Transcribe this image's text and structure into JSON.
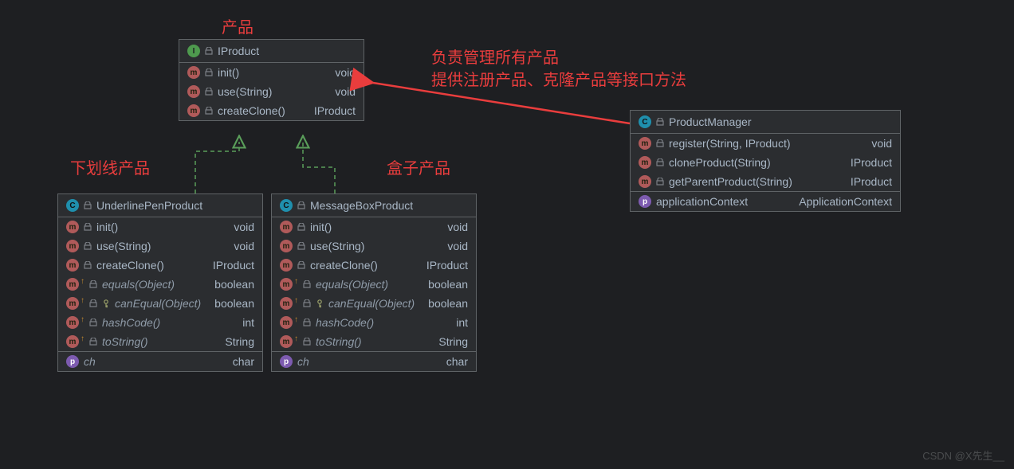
{
  "annotations": {
    "top_center": "产品",
    "left": "下划线产品",
    "middle": "盒子产品",
    "right_line1": "负责管理所有产品",
    "right_line2": "提供注册产品、克隆产品等接口方法"
  },
  "iproduct": {
    "title": "IProduct",
    "rows": [
      {
        "sig": "init()",
        "ret": "void"
      },
      {
        "sig": "use(String)",
        "ret": "void"
      },
      {
        "sig": "createClone()",
        "ret": "IProduct"
      }
    ]
  },
  "underline": {
    "title": "UnderlinePenProduct",
    "rows": [
      {
        "sig": "init()",
        "ret": "void",
        "italic": false,
        "key": false
      },
      {
        "sig": "use(String)",
        "ret": "void",
        "italic": false,
        "key": false
      },
      {
        "sig": "createClone()",
        "ret": "IProduct",
        "italic": false,
        "key": false
      },
      {
        "sig": "equals(Object)",
        "ret": "boolean",
        "italic": true,
        "key": false,
        "up": true
      },
      {
        "sig": "canEqual(Object)",
        "ret": "boolean",
        "italic": true,
        "key": true,
        "up": true
      },
      {
        "sig": "hashCode()",
        "ret": "int",
        "italic": true,
        "key": false,
        "up": true
      },
      {
        "sig": "toString()",
        "ret": "String",
        "italic": true,
        "key": false,
        "up": true
      }
    ],
    "field": {
      "name": "ch",
      "type": "char"
    }
  },
  "messagebox": {
    "title": "MessageBoxProduct",
    "rows": [
      {
        "sig": "init()",
        "ret": "void",
        "italic": false,
        "key": false
      },
      {
        "sig": "use(String)",
        "ret": "void",
        "italic": false,
        "key": false
      },
      {
        "sig": "createClone()",
        "ret": "IProduct",
        "italic": false,
        "key": false
      },
      {
        "sig": "equals(Object)",
        "ret": "boolean",
        "italic": true,
        "key": false,
        "up": true
      },
      {
        "sig": "canEqual(Object)",
        "ret": "boolean",
        "italic": true,
        "key": true,
        "up": true
      },
      {
        "sig": "hashCode()",
        "ret": "int",
        "italic": true,
        "key": false,
        "up": true
      },
      {
        "sig": "toString()",
        "ret": "String",
        "italic": true,
        "key": false,
        "up": true
      }
    ],
    "field": {
      "name": "ch",
      "type": "char"
    }
  },
  "manager": {
    "title": "ProductManager",
    "rows": [
      {
        "sig": "register(String, IProduct)",
        "ret": "void"
      },
      {
        "sig": "cloneProduct(String)",
        "ret": "IProduct"
      },
      {
        "sig": "getParentProduct(String)",
        "ret": "IProduct"
      }
    ],
    "field": {
      "name": "applicationContext",
      "type": "ApplicationContext"
    }
  },
  "watermark": "CSDN @X先生__"
}
